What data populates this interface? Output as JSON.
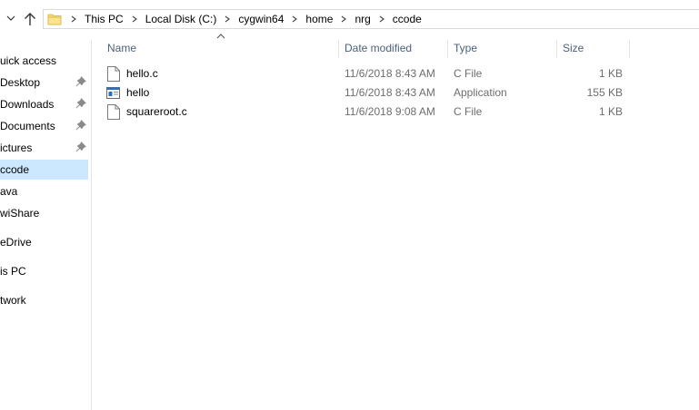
{
  "address": {
    "breadcrumbs": [
      "This PC",
      "Local Disk (C:)",
      "cygwin64",
      "home",
      "nrg",
      "ccode"
    ]
  },
  "sidebar": {
    "items": [
      {
        "label": "Quick access",
        "shown": "uick access",
        "pinned": false,
        "selected": false
      },
      {
        "label": "Desktop",
        "shown": "Desktop",
        "pinned": true,
        "selected": false
      },
      {
        "label": "Downloads",
        "shown": "Downloads",
        "pinned": true,
        "selected": false
      },
      {
        "label": "Documents",
        "shown": "Documents",
        "pinned": true,
        "selected": false
      },
      {
        "label": "Pictures",
        "shown": "ictures",
        "pinned": true,
        "selected": false
      },
      {
        "label": "ccode",
        "shown": "ccode",
        "pinned": false,
        "selected": true
      },
      {
        "label": "Java",
        "shown": "ava",
        "pinned": false,
        "selected": false
      },
      {
        "label": "VwiShare",
        "shown": "wiShare",
        "pinned": false,
        "selected": false
      },
      {
        "label": "OneDrive",
        "shown": "eDrive",
        "pinned": false,
        "selected": false
      },
      {
        "label": "This PC",
        "shown": "is PC",
        "pinned": false,
        "selected": false
      },
      {
        "label": "Network",
        "shown": "twork",
        "pinned": false,
        "selected": false
      }
    ]
  },
  "file_list": {
    "columns": {
      "name": "Name",
      "date": "Date modified",
      "type": "Type",
      "size": "Size"
    },
    "sort": {
      "column": "Name",
      "direction": "ascending"
    },
    "rows": [
      {
        "name": "hello.c",
        "date": "11/6/2018 8:43 AM",
        "type": "C File",
        "size": "1 KB",
        "icon": "document-icon"
      },
      {
        "name": "hello",
        "date": "11/6/2018 8:43 AM",
        "type": "Application",
        "size": "155 KB",
        "icon": "application-icon"
      },
      {
        "name": "squareroot.c",
        "date": "11/6/2018 9:08 AM",
        "type": "C File",
        "size": "1 KB",
        "icon": "document-icon"
      }
    ]
  },
  "colors": {
    "selection": "#cce8ff",
    "header_text": "#4c607a",
    "secondary_text": "#6d6d6d",
    "folder": "#f8d775"
  }
}
